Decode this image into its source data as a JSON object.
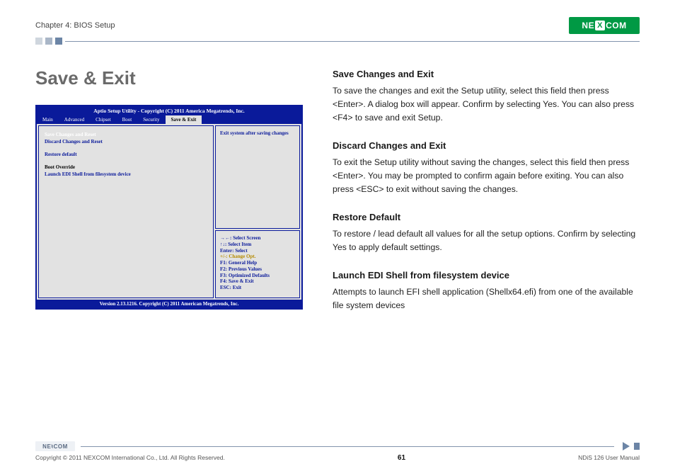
{
  "header": {
    "chapter": "Chapter 4: BIOS Setup",
    "logo_text_a": "NE",
    "logo_text_b": "COM",
    "logo_x": "X"
  },
  "title": "Save & Exit",
  "bios": {
    "title": "Aptio Setup Utility - Copyright (C) 2011 America Megatrends, Inc.",
    "tabs": [
      "Main",
      "Advanced",
      "Chipset",
      "Boot",
      "Security",
      "Save & Exit"
    ],
    "active_tab_index": 5,
    "items": {
      "save_reset": "Save Changes and Reset",
      "discard_reset": "Discard Changes and Reset",
      "restore": "Restore default",
      "boot_override": "Boot Override",
      "launch_shell": "Launch EDI Shell from filesystem device"
    },
    "help_text": "Exit system after saving changes",
    "keys": {
      "k1": "→←: Select Screen",
      "k2": "↑↓: Select Item",
      "k3": "Enter: Select",
      "k4": "+/-: Change Opt.",
      "k5": "F1: General Help",
      "k6": "F2: Previous Values",
      "k7": "F3: Optimized Defaults",
      "k8": "F4: Save & Exit",
      "k9": "ESC: Exit"
    },
    "foot": "Version 2.13.1216. Copyright (C) 2011 American Megatrends, Inc."
  },
  "sections": {
    "s1": {
      "h": "Save Changes and Exit",
      "p": "To save the changes and exit the Setup utility, select this field then press <Enter>. A dialog box will appear. Confirm by selecting Yes. You can also press <F4> to save and exit Setup."
    },
    "s2": {
      "h": "Discard Changes and Exit",
      "p": "To exit the Setup utility without saving the changes, select this field then press <Enter>. You may be prompted to confirm again before exiting. You can also press <ESC> to exit without saving the changes."
    },
    "s3": {
      "h": "Restore Default",
      "p": "To restore / lead default all values for all the setup options. Confirm by selecting Yes to apply default settings."
    },
    "s4": {
      "h": "Launch EDI Shell from filesystem device",
      "p": "Attempts to launch EFI shell application (Shellx64.efi) from one of the available file system devices"
    }
  },
  "footer": {
    "copyright": "Copyright © 2011 NEXCOM International Co., Ltd. All Rights Reserved.",
    "page": "61",
    "manual": "NDiS 126 User Manual",
    "mini": "NE♮COM"
  }
}
